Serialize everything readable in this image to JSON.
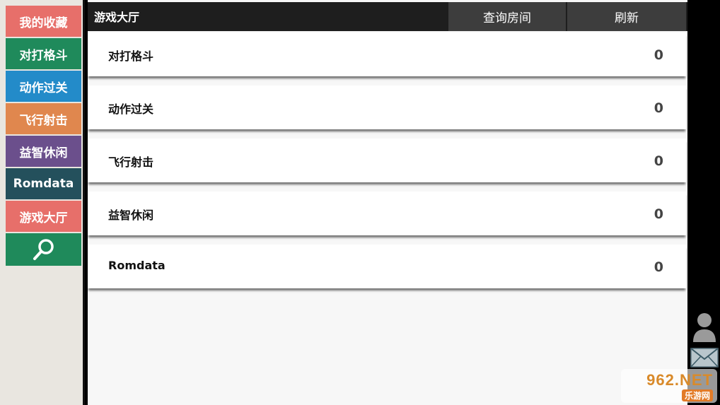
{
  "sidebar": {
    "items": [
      {
        "label": "我的收藏",
        "color": "#e76f6a"
      },
      {
        "label": "对打格斗",
        "color": "#1f8a5b"
      },
      {
        "label": "动作过关",
        "color": "#238bc9"
      },
      {
        "label": "飞行射击",
        "color": "#e0874e"
      },
      {
        "label": "益智休闲",
        "color": "#6b4f8c"
      },
      {
        "label": "Romdata",
        "color": "#24505c"
      },
      {
        "label": "游戏大厅",
        "color": "#e76f6a",
        "active": true
      }
    ],
    "search": {
      "icon": "search-icon",
      "color": "#1f8a5b"
    }
  },
  "topbar": {
    "title": "游戏大厅",
    "query_label": "查询房间",
    "refresh_label": "刷新"
  },
  "rooms": [
    {
      "name": "对打格斗",
      "count": "0"
    },
    {
      "name": "动作过关",
      "count": "0"
    },
    {
      "name": "飞行射击",
      "count": "0"
    },
    {
      "name": "益智休闲",
      "count": "0"
    },
    {
      "name": "Romdata",
      "count": "0"
    }
  ],
  "right": {
    "person_icon": "person-icon",
    "mail_icon": "mail-icon"
  },
  "watermark": {
    "top": "962.NET",
    "bottom": "乐游网"
  }
}
